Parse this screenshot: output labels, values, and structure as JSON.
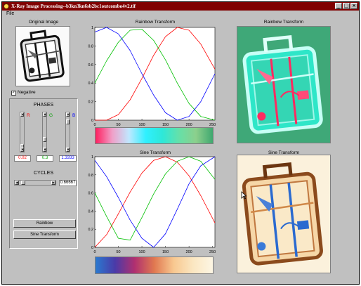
{
  "window": {
    "title": "X-Ray Image Processing--b3kn3kn6sb2bc1outcombo4v2.tif"
  },
  "menu": {
    "file": "File"
  },
  "left": {
    "original_title": "Original Image",
    "negative_label": "Negative",
    "negative_checked": true,
    "phases_title": "PHASES",
    "r_label": "R",
    "g_label": "G",
    "b_label": "B",
    "r_value": "0.02",
    "g_value": "0.3",
    "b_value": "1.3333",
    "cycles_title": "CYCLES",
    "cycles_value": "0.66667",
    "rainbow_button": "Rainbow",
    "sine_button": "Sine Transform"
  },
  "plots": {
    "rainbow_title": "Rainbow Transform",
    "sine_title": "Sine Transform",
    "y_ticks": [
      "0",
      "0.2",
      "0.4",
      "0.6",
      "0.8",
      "1"
    ],
    "x_ticks": [
      "0",
      "50",
      "100",
      "150",
      "200",
      "250"
    ]
  },
  "right": {
    "rainbow_image_title": "Rainbow Transform",
    "sine_image_title": "Sine Transform"
  },
  "chart_data": [
    {
      "type": "line",
      "title": "Rainbow Transform",
      "xlim": [
        0,
        255
      ],
      "ylim": [
        0,
        1
      ],
      "x": [
        0,
        25,
        50,
        75,
        100,
        125,
        150,
        175,
        200,
        225,
        255
      ],
      "series": [
        {
          "color": "#ff0000",
          "values": [
            0.0,
            0.0,
            0.06,
            0.22,
            0.45,
            0.7,
            0.9,
            1.0,
            0.97,
            0.82,
            0.55
          ]
        },
        {
          "color": "#00c000",
          "values": [
            0.4,
            0.64,
            0.84,
            0.97,
            0.98,
            0.86,
            0.65,
            0.4,
            0.18,
            0.04,
            0.0
          ]
        },
        {
          "color": "#0000ff",
          "values": [
            0.95,
            1.0,
            0.93,
            0.75,
            0.5,
            0.27,
            0.08,
            0.0,
            0.04,
            0.2,
            0.5
          ]
        }
      ],
      "colormap": [
        "#ff1f60",
        "#f0a0c8",
        "#bfe8ff",
        "#2ff0ff",
        "#2ee8d8",
        "#66e0a8",
        "#8ccf8c",
        "#3fa870"
      ]
    },
    {
      "type": "line",
      "title": "Sine Transform",
      "xlim": [
        0,
        255
      ],
      "ylim": [
        0,
        1
      ],
      "x": [
        0,
        25,
        50,
        75,
        100,
        125,
        150,
        175,
        200,
        225,
        255
      ],
      "series": [
        {
          "color": "#ff0000",
          "values": [
            0.0,
            0.14,
            0.37,
            0.61,
            0.82,
            0.96,
            1.0,
            0.94,
            0.79,
            0.57,
            0.27
          ]
        },
        {
          "color": "#00c000",
          "values": [
            0.6,
            0.34,
            0.1,
            0.08,
            0.33,
            0.59,
            0.81,
            0.95,
            1.0,
            0.95,
            0.75
          ]
        },
        {
          "color": "#0000ff",
          "values": [
            0.96,
            0.78,
            0.55,
            0.3,
            0.1,
            0.0,
            0.15,
            0.42,
            0.7,
            0.9,
            1.0
          ]
        }
      ],
      "colormap": [
        "#2a7ad0",
        "#4a3aa8",
        "#b03070",
        "#e07850",
        "#f8c890",
        "#fbe7c2",
        "#fdf6e4"
      ]
    }
  ]
}
